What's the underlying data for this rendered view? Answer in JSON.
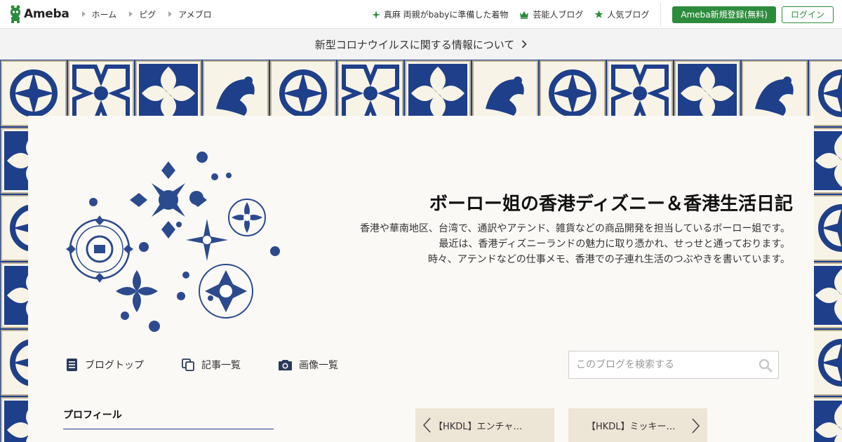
{
  "header": {
    "logo_text": "Ameba",
    "nav": [
      {
        "label": "ホーム"
      },
      {
        "label": "ピグ"
      },
      {
        "label": "アメブロ"
      }
    ],
    "links": [
      {
        "label": "真麻 両親がbabyに準備した着物",
        "icon": "sparkle-icon"
      },
      {
        "label": "芸能人ブログ",
        "icon": "crown-icon"
      },
      {
        "label": "人気ブログ",
        "icon": "star-icon"
      }
    ],
    "register_label": "Ameba新規登録(無料)",
    "login_label": "ログイン"
  },
  "notice": {
    "text": "新型コロナウイルスに関する情報について"
  },
  "blog": {
    "title": "ボーロー姐の香港ディズニー＆香港生活日記",
    "description_lines": [
      "香港や華南地区、台湾で、通訳やアテンド、雑貨などの商品開発を担当しているボーロー姐です。",
      "最近は、香港ディズニーランドの魅力に取り憑かれ、せっせと通っております。",
      "時々、アテンドなどの仕事メモ、香港での子連れ生活のつぶやきを書いています。"
    ]
  },
  "subnav": [
    {
      "label": "ブログトップ",
      "icon": "document-icon"
    },
    {
      "label": "記事一覧",
      "icon": "copy-icon"
    },
    {
      "label": "画像一覧",
      "icon": "camera-icon"
    }
  ],
  "search": {
    "placeholder": "このブログを検索する",
    "value": ""
  },
  "sidebar": {
    "profile_heading": "プロフィール"
  },
  "pager": {
    "prev_label": "【HKDL】エンチャ…",
    "next_label": "【HKDL】ミッキー…"
  },
  "colors": {
    "brand_green": "#2d8c3c",
    "tile_blue": "#1e3f8a",
    "tile_cream": "#f7f3e6",
    "card_bg": "#fbf9f6"
  }
}
